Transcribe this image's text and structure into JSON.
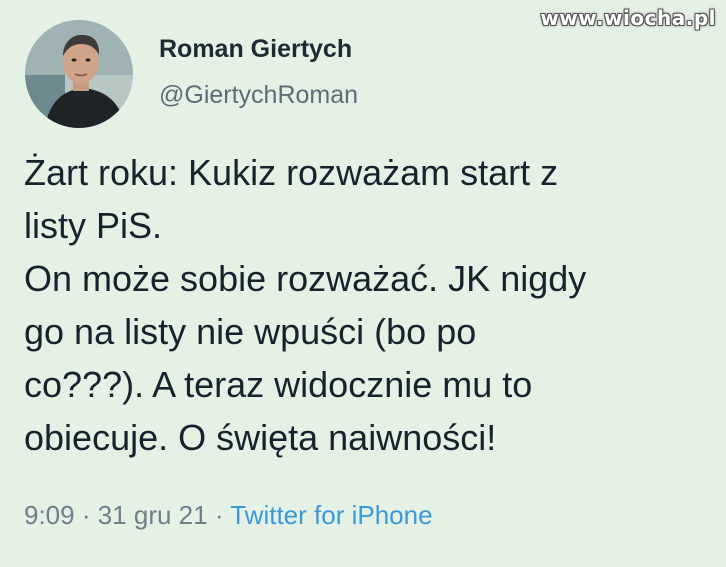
{
  "watermark": "www.wiocha.pl",
  "author": {
    "name": "Roman Giertych",
    "handle": "@GiertychRoman"
  },
  "tweet": {
    "lines": [
      "Żart roku: Kukiz rozważam start z",
      "listy PiS.",
      "On może sobie rozważać. JK nigdy",
      "go na listy nie wpuści (bo po",
      "co???). A teraz widocznie mu to",
      "obiecuje. O święta naiwności!"
    ]
  },
  "meta": {
    "time": "9:09",
    "separator": " · ",
    "date": "31 gru 21",
    "source": "Twitter for iPhone"
  },
  "colors": {
    "background": "#e6f1e6",
    "text": "#15232c",
    "secondary": "#5b6e78",
    "link": "#3a9ad9"
  }
}
